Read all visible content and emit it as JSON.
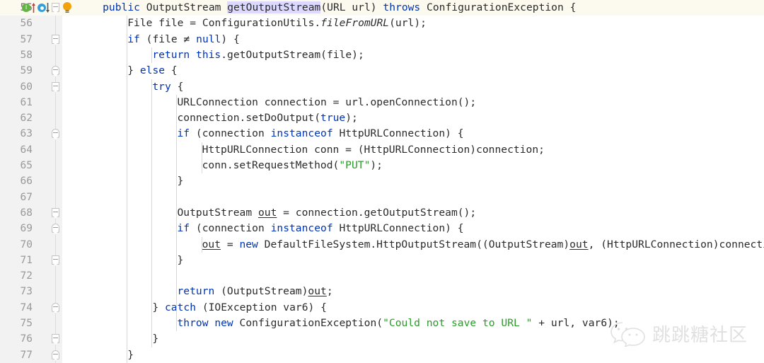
{
  "editor": {
    "first_line": 55,
    "last_line": 77,
    "current_line": 55,
    "colors": {
      "background": "#ffffff",
      "gutter": "#f2f2f2",
      "current_line_highlight": "#fcfaef",
      "line_number": "#999999",
      "keyword": "#0033b3",
      "string": "#2a9b2a",
      "text": "#2b2b2b",
      "symbol_highlight": "#ddd8ff",
      "indent_guide": "#d8d8d8",
      "impl_marker": "#62b543",
      "override_marker": "#389fd6",
      "bulb": "#f0a30a"
    },
    "gutter_icons": [
      {
        "name": "implemented-marker",
        "line": 55,
        "title": "I"
      },
      {
        "name": "arrow-up-marker",
        "line": 55
      },
      {
        "name": "overridden-marker",
        "line": 55
      },
      {
        "name": "arrow-down-marker",
        "line": 55
      },
      {
        "name": "intention-bulb",
        "line": 55
      }
    ],
    "fold_lines": [
      55,
      57,
      59,
      60,
      63,
      68,
      69,
      71,
      74,
      76,
      77
    ],
    "lines": [
      {
        "num": 55,
        "indent": 4,
        "tokens": [
          {
            "t": "public",
            "c": "kw"
          },
          {
            "t": " OutputStream ",
            "c": "plain"
          },
          {
            "t": "getOutputStream",
            "c": "hl-sym"
          },
          {
            "t": "(URL url) ",
            "c": "plain"
          },
          {
            "t": "throws",
            "c": "kw"
          },
          {
            "t": " ConfigurationException {",
            "c": "plain"
          }
        ]
      },
      {
        "num": 56,
        "indent": 8,
        "tokens": [
          {
            "t": "File file = ConfigurationUtils.",
            "c": "plain"
          },
          {
            "t": "fileFromURL",
            "c": "stat"
          },
          {
            "t": "(url);",
            "c": "plain"
          }
        ]
      },
      {
        "num": 57,
        "indent": 8,
        "tokens": [
          {
            "t": "if",
            "c": "kw"
          },
          {
            "t": " (file ",
            "c": "plain"
          },
          {
            "t": "≠",
            "c": "plain"
          },
          {
            "t": " ",
            "c": "plain"
          },
          {
            "t": "null",
            "c": "kw"
          },
          {
            "t": ") {",
            "c": "plain"
          }
        ]
      },
      {
        "num": 58,
        "indent": 12,
        "tokens": [
          {
            "t": "return",
            "c": "kw"
          },
          {
            "t": " ",
            "c": "plain"
          },
          {
            "t": "this",
            "c": "kw"
          },
          {
            "t": ".getOutputStream(file);",
            "c": "plain"
          }
        ]
      },
      {
        "num": 59,
        "indent": 8,
        "tokens": [
          {
            "t": "} ",
            "c": "plain"
          },
          {
            "t": "else",
            "c": "kw"
          },
          {
            "t": " {",
            "c": "plain"
          }
        ]
      },
      {
        "num": 60,
        "indent": 12,
        "tokens": [
          {
            "t": "try",
            "c": "kw"
          },
          {
            "t": " {",
            "c": "plain"
          }
        ]
      },
      {
        "num": 61,
        "indent": 16,
        "tokens": [
          {
            "t": "URLConnection connection = url.openConnection();",
            "c": "plain"
          }
        ]
      },
      {
        "num": 62,
        "indent": 16,
        "tokens": [
          {
            "t": "connection.setDoOutput(",
            "c": "plain"
          },
          {
            "t": "true",
            "c": "kw"
          },
          {
            "t": ");",
            "c": "plain"
          }
        ]
      },
      {
        "num": 63,
        "indent": 16,
        "tokens": [
          {
            "t": "if",
            "c": "kw"
          },
          {
            "t": " (connection ",
            "c": "plain"
          },
          {
            "t": "instanceof",
            "c": "kw"
          },
          {
            "t": " HttpURLConnection) {",
            "c": "plain"
          }
        ]
      },
      {
        "num": 64,
        "indent": 20,
        "tokens": [
          {
            "t": "HttpURLConnection conn = (HttpURLConnection)connection;",
            "c": "plain"
          }
        ]
      },
      {
        "num": 65,
        "indent": 20,
        "tokens": [
          {
            "t": "conn.setRequestMethod(",
            "c": "plain"
          },
          {
            "t": "\"PUT\"",
            "c": "str"
          },
          {
            "t": ");",
            "c": "plain"
          }
        ]
      },
      {
        "num": 66,
        "indent": 16,
        "tokens": [
          {
            "t": "}",
            "c": "plain"
          }
        ]
      },
      {
        "num": 67,
        "indent": 0,
        "tokens": []
      },
      {
        "num": 68,
        "indent": 16,
        "tokens": [
          {
            "t": "OutputStream ",
            "c": "plain"
          },
          {
            "t": "out",
            "c": "reassigned"
          },
          {
            "t": " = connection.getOutputStream();",
            "c": "plain"
          }
        ]
      },
      {
        "num": 69,
        "indent": 16,
        "tokens": [
          {
            "t": "if",
            "c": "kw"
          },
          {
            "t": " (connection ",
            "c": "plain"
          },
          {
            "t": "instanceof",
            "c": "kw"
          },
          {
            "t": " HttpURLConnection) {",
            "c": "plain"
          }
        ]
      },
      {
        "num": 70,
        "indent": 20,
        "tokens": [
          {
            "t": "out",
            "c": "reassigned"
          },
          {
            "t": " = ",
            "c": "plain"
          },
          {
            "t": "new",
            "c": "kw"
          },
          {
            "t": " DefaultFileSystem.HttpOutputStream((OutputStream)",
            "c": "plain"
          },
          {
            "t": "out",
            "c": "reassigned"
          },
          {
            "t": ", (HttpURLConnection)connection);",
            "c": "plain"
          }
        ]
      },
      {
        "num": 71,
        "indent": 16,
        "tokens": [
          {
            "t": "}",
            "c": "plain"
          }
        ]
      },
      {
        "num": 72,
        "indent": 0,
        "tokens": []
      },
      {
        "num": 73,
        "indent": 16,
        "tokens": [
          {
            "t": "return",
            "c": "kw"
          },
          {
            "t": " (OutputStream)",
            "c": "plain"
          },
          {
            "t": "out",
            "c": "reassigned"
          },
          {
            "t": ";",
            "c": "plain"
          }
        ]
      },
      {
        "num": 74,
        "indent": 12,
        "tokens": [
          {
            "t": "} ",
            "c": "plain"
          },
          {
            "t": "catch",
            "c": "kw"
          },
          {
            "t": " (IOException var6) {",
            "c": "plain"
          }
        ]
      },
      {
        "num": 75,
        "indent": 16,
        "tokens": [
          {
            "t": "throw",
            "c": "kw"
          },
          {
            "t": " ",
            "c": "plain"
          },
          {
            "t": "new",
            "c": "kw"
          },
          {
            "t": " ConfigurationException(",
            "c": "plain"
          },
          {
            "t": "\"Could not save to URL \"",
            "c": "str"
          },
          {
            "t": " + url, var6);",
            "c": "plain"
          }
        ]
      },
      {
        "num": 76,
        "indent": 12,
        "tokens": [
          {
            "t": "}",
            "c": "plain"
          }
        ]
      },
      {
        "num": 77,
        "indent": 8,
        "tokens": [
          {
            "t": "}",
            "c": "plain"
          }
        ]
      }
    ],
    "indent_guides": [
      {
        "col": 8,
        "from": 56,
        "to": 77
      },
      {
        "col": 12,
        "from": 58,
        "to": 58
      },
      {
        "col": 12,
        "from": 60,
        "to": 76
      },
      {
        "col": 16,
        "from": 61,
        "to": 75
      },
      {
        "col": 20,
        "from": 64,
        "to": 65
      },
      {
        "col": 20,
        "from": 70,
        "to": 70
      }
    ]
  },
  "watermark": {
    "icon": "wechat-icon",
    "text": "跳跳糖社区"
  }
}
